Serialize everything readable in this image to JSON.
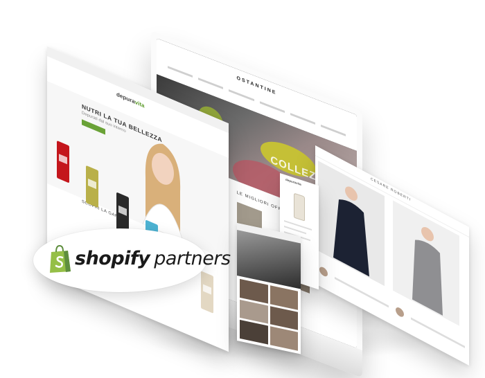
{
  "scene": {
    "left_site": {
      "logo_prefix": "depura",
      "logo_suffix": "vita",
      "hero_title": "NUTRI LA TUA BELLEZZA",
      "hero_subtitle": "Depurati dal suo interno",
      "section_title": "SCOPRI LA GAMMA",
      "pack_colors": [
        "#c4161c",
        "#b9b04a",
        "#2a2a2a",
        "#4db3d3",
        "#e3d8c3"
      ]
    },
    "monitor_site": {
      "logo": "OSTANTINE",
      "hero_text": "COLLEZIONE",
      "section_title": "LE MIGLIORI OFFERTE PER TE"
    },
    "right_site": {
      "logo": "CESARE ROBERTI"
    },
    "product_panel": {
      "logo": "depuravita"
    },
    "badge": {
      "brand": "shopify",
      "suffix": "partners",
      "bag_color": "#95bf47"
    }
  }
}
